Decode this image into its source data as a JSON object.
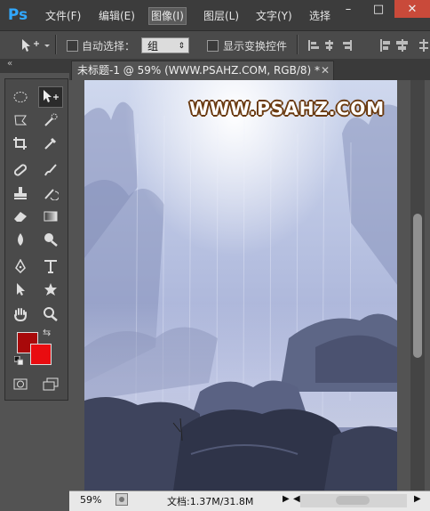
{
  "app": {
    "logo": "Ps"
  },
  "menu": {
    "items": [
      {
        "label": "文件(F)"
      },
      {
        "label": "编辑(E)"
      },
      {
        "label": "图像(I)"
      },
      {
        "label": "图层(L)"
      },
      {
        "label": "文字(Y)"
      },
      {
        "label": "选择"
      }
    ],
    "active_index": 2
  },
  "window_controls": {
    "minimize": "–",
    "restore": "□",
    "close": "✕"
  },
  "options": {
    "auto_select_label": "自动选择：",
    "auto_select_value": "组",
    "show_transform_label": "显示变换控件"
  },
  "document": {
    "tab_title": "未标题-1 @ 59% (WWW.PSAHZ.COM, RGB/8) *",
    "watermark": "WWW.PSAHZ.COM"
  },
  "colors": {
    "foreground": "#a8090a",
    "background": "#e90c10"
  },
  "status": {
    "zoom": "59%",
    "doc_size": "文档:1.37M/31.8M"
  },
  "icons": [
    "marquee-icon",
    "move-icon",
    "lasso-icon",
    "quick-select-icon",
    "crop-icon",
    "eyedropper-icon",
    "healing-icon",
    "brush-icon",
    "stamp-icon",
    "history-brush-icon",
    "eraser-icon",
    "gradient-icon",
    "blur-icon",
    "dodge-icon",
    "pen-icon",
    "type-icon",
    "path-select-icon",
    "shape-icon",
    "hand-icon",
    "zoom-icon"
  ]
}
